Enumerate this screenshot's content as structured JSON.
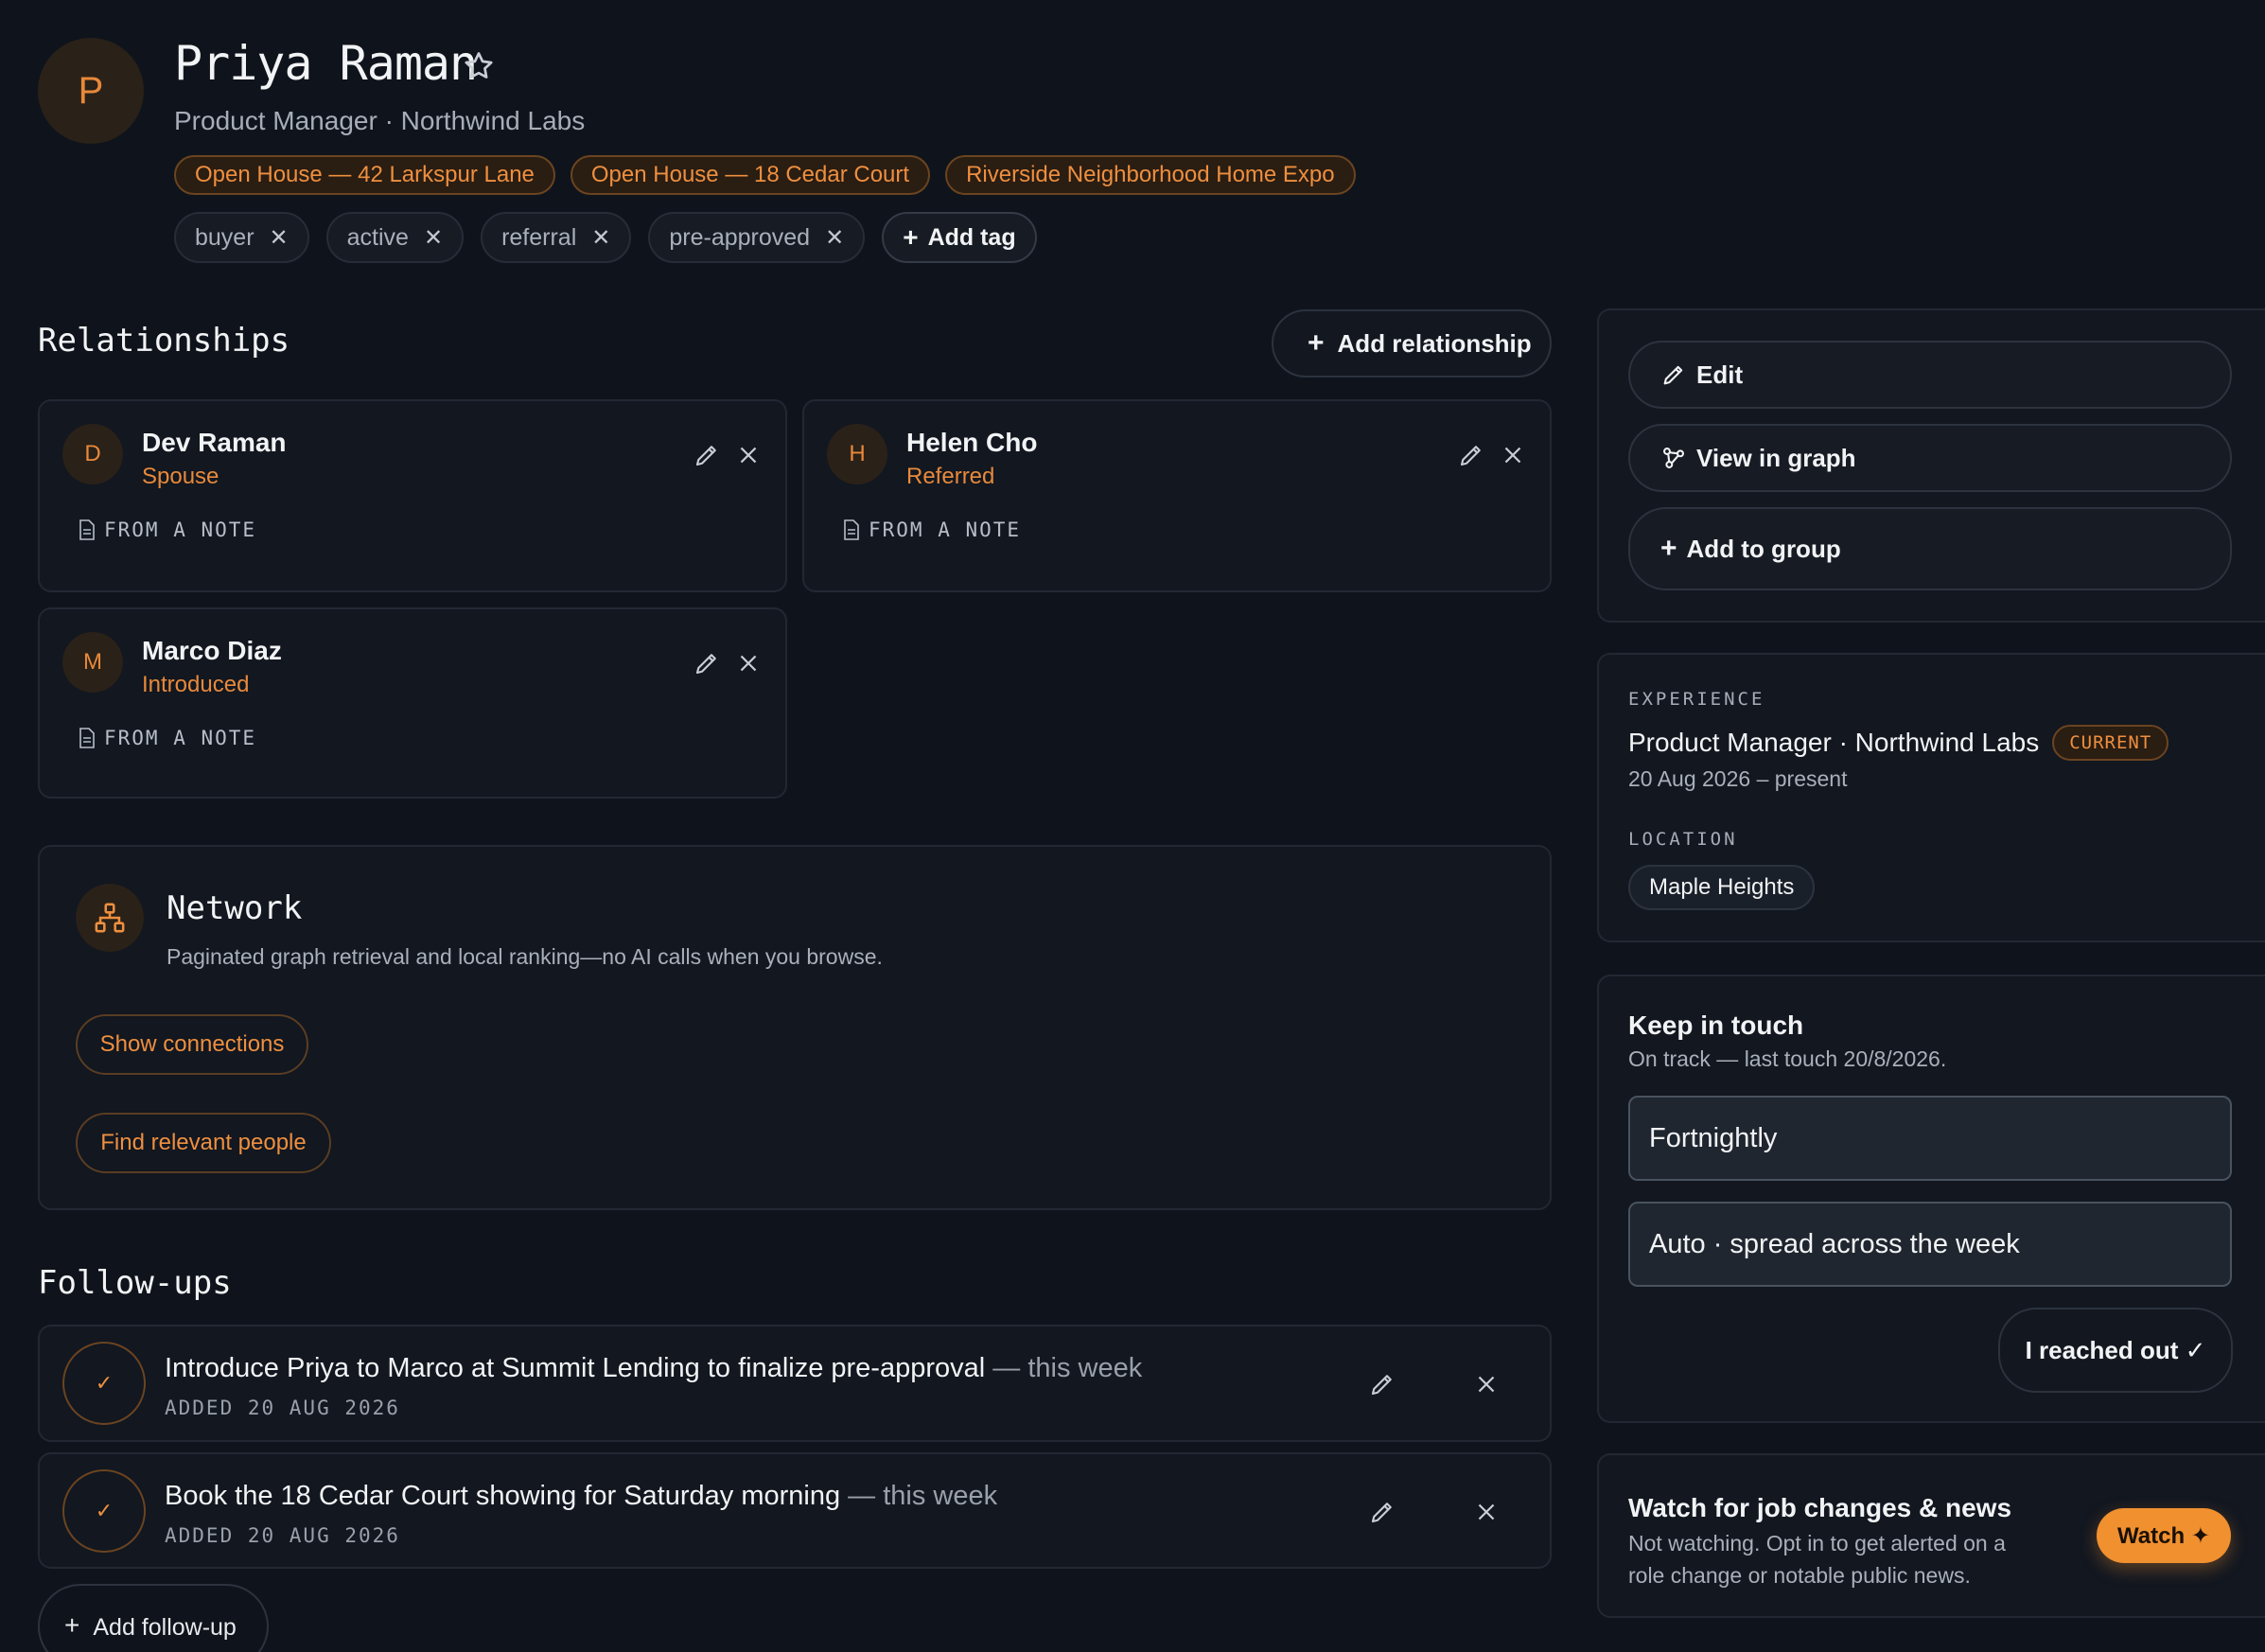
{
  "profile": {
    "initial": "P",
    "name": "Priya Raman",
    "subtitle": "Product Manager · Northwind Labs",
    "events": [
      "Open House — 42 Larkspur Lane",
      "Open House — 18 Cedar Court",
      "Riverside Neighborhood Home Expo"
    ],
    "tags": [
      "buyer",
      "active",
      "referral",
      "pre-approved"
    ],
    "add_tag_label": "Add tag"
  },
  "relationships": {
    "title": "Relationships",
    "add_label": "Add relationship",
    "items": [
      {
        "initial": "D",
        "name": "Dev Raman",
        "type": "Spouse",
        "source": "FROM A NOTE"
      },
      {
        "initial": "H",
        "name": "Helen Cho",
        "type": "Referred",
        "source": "FROM A NOTE"
      },
      {
        "initial": "M",
        "name": "Marco Diaz",
        "type": "Introduced",
        "source": "FROM A NOTE"
      }
    ]
  },
  "network": {
    "title": "Network",
    "description": "Paginated graph retrieval and local ranking—no AI calls when you browse.",
    "show_connections": "Show connections",
    "find_people": "Find relevant people"
  },
  "followups": {
    "title": "Follow-ups",
    "items": [
      {
        "text": "Introduce Priya to Marco at Summit Lending to finalize pre-approval",
        "due": " — this week",
        "added": "ADDED 20 AUG 2026"
      },
      {
        "text": "Book the 18 Cedar Court showing for Saturday morning",
        "due": " — this week",
        "added": "ADDED 20 AUG 2026"
      }
    ],
    "add_label": "Add follow-up"
  },
  "actions": {
    "edit": "Edit",
    "view_graph": "View in graph",
    "add_group": "Add to group"
  },
  "experience": {
    "label": "EXPERIENCE",
    "role": "Product Manager · Northwind Labs",
    "badge": "CURRENT",
    "dates": "20 Aug 2026 – present",
    "location_label": "LOCATION",
    "location": "Maple Heights"
  },
  "keep_in_touch": {
    "title": "Keep in touch",
    "status": "On track — last touch 20/8/2026.",
    "frequency": "Fortnightly",
    "schedule": "Auto · spread across the week",
    "reached_out": "I reached out ✓"
  },
  "watch": {
    "title": "Watch for job changes & news",
    "description_line1": "Not watching. Opt in to get alerted on a",
    "description_line2": "role change or notable public news.",
    "button": "Watch ✦"
  },
  "colors": {
    "accent": "#ee8f3f",
    "background": "#0f141c",
    "card": "#121720"
  }
}
